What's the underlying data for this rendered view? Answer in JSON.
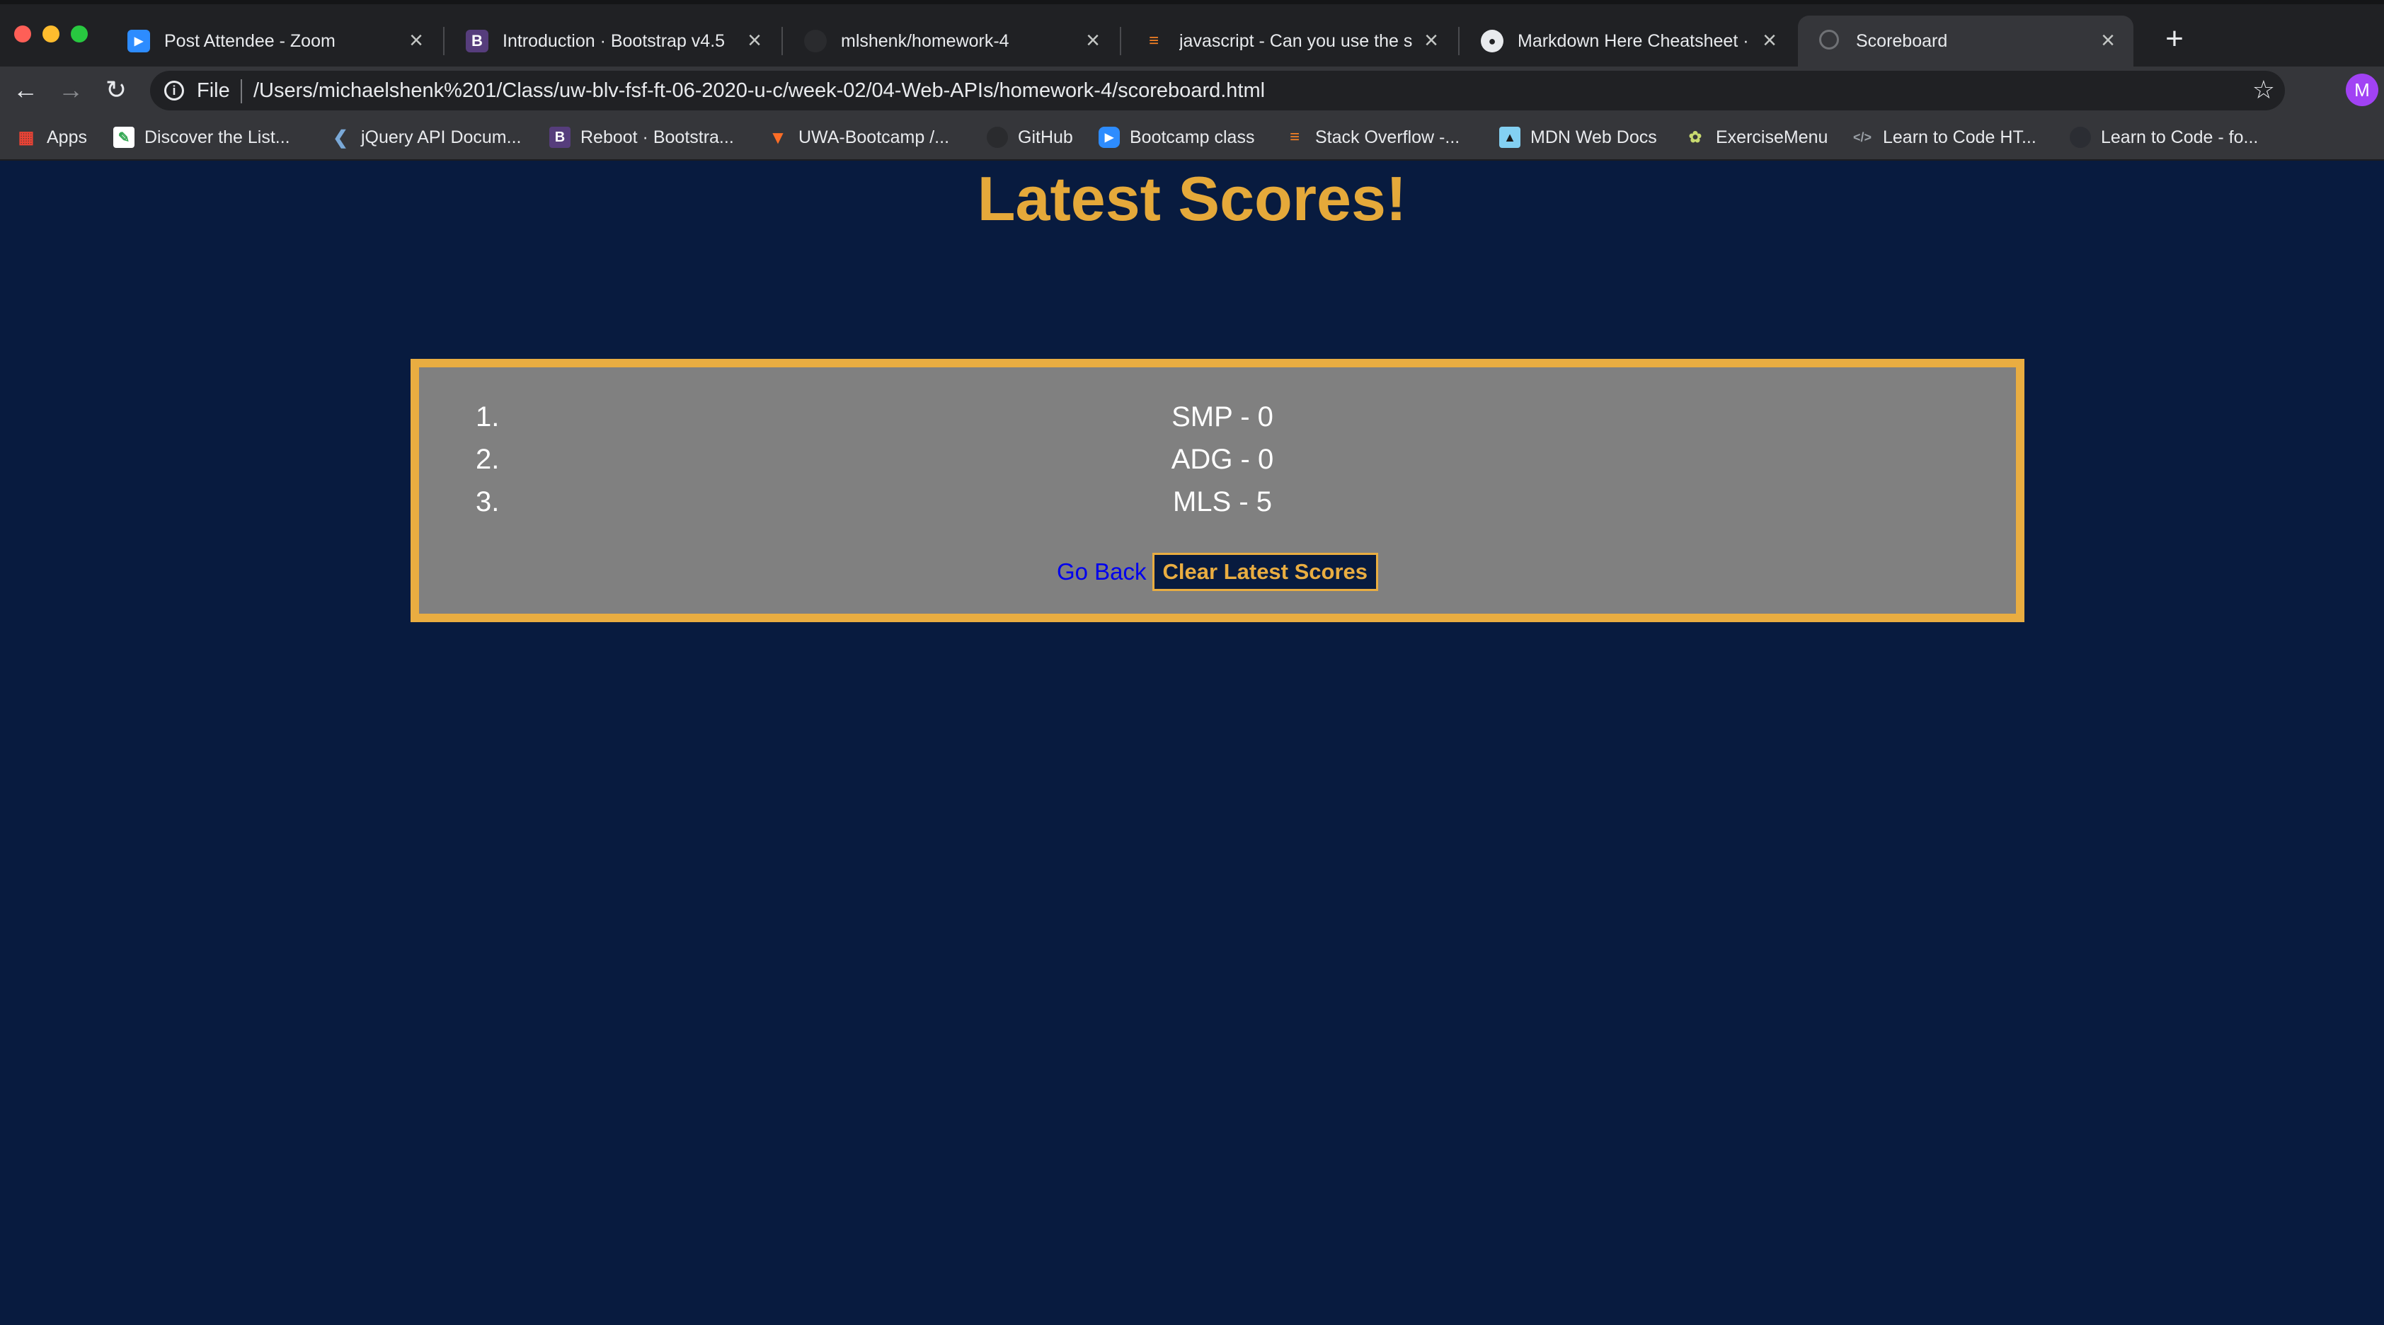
{
  "browser": {
    "tabs": [
      {
        "title": "Post Attendee - Zoom",
        "icon": "zoom-icon",
        "active": false
      },
      {
        "title": "Introduction · Bootstrap v4.5",
        "icon": "bootstrap-icon",
        "active": false
      },
      {
        "title": "mlshenk/homework-4",
        "icon": "github-icon",
        "active": false
      },
      {
        "title": "javascript - Can you use the sa",
        "icon": "stackoverflow-icon",
        "active": false
      },
      {
        "title": "Markdown Here Cheatsheet · a",
        "icon": "github-icon",
        "active": false
      },
      {
        "title": "Scoreboard",
        "icon": "globe-icon",
        "active": true
      }
    ],
    "address": {
      "scheme_label": "File",
      "url": "/Users/michaelshenk%201/Class/uw-blv-fsf-ft-06-2020-u-c/week-02/04-Web-APIs/homework-4/scoreboard.html"
    },
    "profile_initial": "M",
    "bookmarks": [
      {
        "label": "Apps",
        "icon": "apps-grid-icon"
      },
      {
        "label": "Discover the List...",
        "icon": "notepad-icon"
      },
      {
        "label": "jQuery API Docum...",
        "icon": "jquery-icon"
      },
      {
        "label": "Reboot · Bootstra...",
        "icon": "bootstrap-icon"
      },
      {
        "label": "UWA-Bootcamp /...",
        "icon": "gitlab-icon"
      },
      {
        "label": "GitHub",
        "icon": "github-icon"
      },
      {
        "label": "Bootcamp class",
        "icon": "zoom-icon"
      },
      {
        "label": "Stack Overflow -...",
        "icon": "stackoverflow-icon"
      },
      {
        "label": "MDN Web Docs",
        "icon": "mdn-icon"
      },
      {
        "label": "ExerciseMenu",
        "icon": "exercise-icon"
      },
      {
        "label": "Learn to Code HT...",
        "icon": "code-icon"
      },
      {
        "label": "Learn to Code - fo...",
        "icon": "freecodecamp-icon"
      }
    ]
  },
  "page": {
    "title": "Latest Scores!",
    "scores": [
      {
        "rank": "1.",
        "entry": "SMP - 0"
      },
      {
        "rank": "2.",
        "entry": "ADG - 0"
      },
      {
        "rank": "3.",
        "entry": "MLS - 5"
      }
    ],
    "go_back_label": "Go Back",
    "clear_label": "Clear Latest Scores"
  },
  "colors": {
    "background": "#081b3f",
    "accent": "#e9ad41",
    "board": "#808080",
    "link": "#0000ee"
  }
}
